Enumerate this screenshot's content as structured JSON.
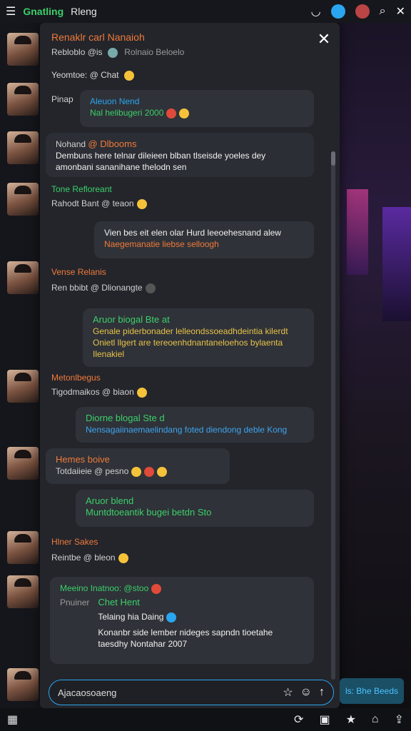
{
  "topbar": {
    "title": "Gnatling",
    "tab2": "Rleng",
    "icons": [
      "menu-icon",
      "wifi-icon",
      "bluetooth-icon",
      "battery-icon",
      "search-icon",
      "close-icon"
    ]
  },
  "panel": {
    "header_title": "Renaklr carl Nanaioh",
    "header_sub": "Rebloblo @is",
    "header_sub2": "Rolnaio Beloelo",
    "info_line": "Yeomtoe: @ Chat",
    "info_label": "Yeomtoe:"
  },
  "messages": [
    {
      "id": "m1",
      "name": "Pinap",
      "bubble_title": "Aleuon Nend",
      "text": "Nal helibugeri 2000",
      "type": "bubble"
    },
    {
      "id": "m2",
      "name": "Nohand",
      "label": "@ Dlbooms",
      "text": "Dembuns here telnar dileieen blban tlseisde yoeles dey amonbani sananihane thelodn sen",
      "type": "plain"
    },
    {
      "id": "m3",
      "name": "Tone Refloreant",
      "sub": "Rahodt Bant @ teaon",
      "type": "user"
    },
    {
      "id": "m4",
      "bubble_title": "Vien bes eit elen olar Hurd leeoehesnand alew",
      "text": "Naegemanatie liebse selloogh",
      "type": "bubble"
    },
    {
      "id": "m5",
      "name": "Vense Relanis",
      "sub": "Ren bbibt @ Dlionangte",
      "type": "user"
    },
    {
      "id": "m6",
      "bubble_title": "Aruor biogal Bte at",
      "text": "Genale piderbonader lelleondssoeadhdeintia kilerdt Onietl llgert are tereoenhdnantaneloehos bylaenta Ilenakiel",
      "type": "bubble"
    },
    {
      "id": "m7",
      "name": "Metonlbegus",
      "sub": "Tigodmaikos @ biaon",
      "type": "user"
    },
    {
      "id": "m8",
      "bubble_title": "Diorne blogal Ste d",
      "text": "Nensagaiinaemaelindang foted diendong deble Kong",
      "type": "bubble"
    },
    {
      "id": "m9",
      "name": "Hemes boive",
      "sub": "Totdaiieie @ pesno",
      "type": "user"
    },
    {
      "id": "m10",
      "bubble_title": "Aruor blend",
      "text": "Muntdtoeantik bugei betdn Sto",
      "type": "bubble"
    },
    {
      "id": "m11",
      "name": "Hlner Sakes",
      "sub": "Reintbe @ bleon",
      "type": "user"
    },
    {
      "id": "m12",
      "header": "Meeino Inatnoo: @stoo",
      "name": "Pnuiner",
      "title": "Chet Hent",
      "sub": "Telaing hia Daing",
      "text": "Konanbr side lember nideges sapndn tioetahe taesdhy Nontahar 2007",
      "type": "card"
    }
  ],
  "composer": {
    "placeholder": "Ajacaosoaeng",
    "send_icon": "send-icon"
  },
  "right_button": "ls: Bhe Beeds",
  "bottom_icons": [
    "grid-icon",
    "refresh-icon",
    "notes-icon",
    "star-icon",
    "home-icon",
    "share-icon"
  ]
}
